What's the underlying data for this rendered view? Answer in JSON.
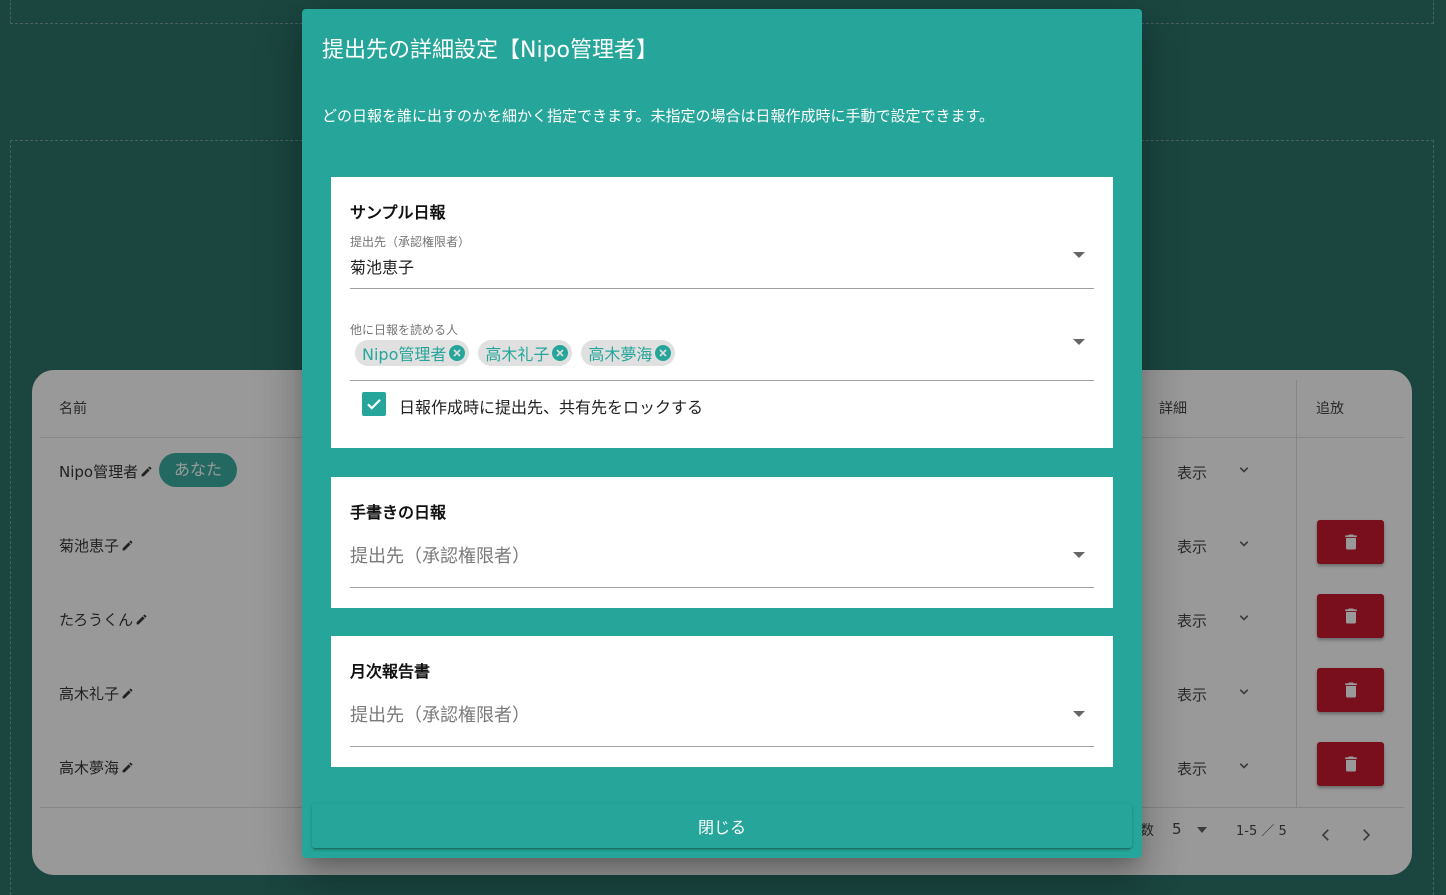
{
  "table": {
    "headers": {
      "name": "名前",
      "details": "詳細",
      "expel": "追放"
    },
    "you_badge": "あなた",
    "show_label": "表示",
    "rows": [
      {
        "name": "Nipo管理者"
      },
      {
        "name": "菊池恵子"
      },
      {
        "name": "たろうくん"
      },
      {
        "name": "高木礼子"
      },
      {
        "name": "高木夢海"
      }
    ],
    "footer": {
      "rows_per_page_partial": "数",
      "rows_per_page_value": "5",
      "page_range": "1-5 ／ 5"
    }
  },
  "dialog": {
    "title": "提出先の詳細設定【Nipo管理者】",
    "description": "どの日報を誰に出すのかを細かく指定できます。未指定の場合は日報作成時に手動で設定できます。",
    "panels": [
      {
        "title": "サンプル日報",
        "submit_label": "提出先（承認権限者）",
        "submit_value": "菊池恵子",
        "readers_label": "他に日報を読める人",
        "readers": [
          "Nipo管理者",
          "高木礼子",
          "高木夢海"
        ],
        "lock_checked": true,
        "lock_label": "日報作成時に提出先、共有先をロックする"
      },
      {
        "title": "手書きの日報",
        "submit_placeholder": "提出先（承認権限者）"
      },
      {
        "title": "月次報告書",
        "submit_placeholder": "提出先（承認権限者）"
      }
    ],
    "close_label": "閉じる"
  },
  "colors": {
    "primary": "#26a69a",
    "background": "#17665c",
    "danger": "#c4001a"
  }
}
